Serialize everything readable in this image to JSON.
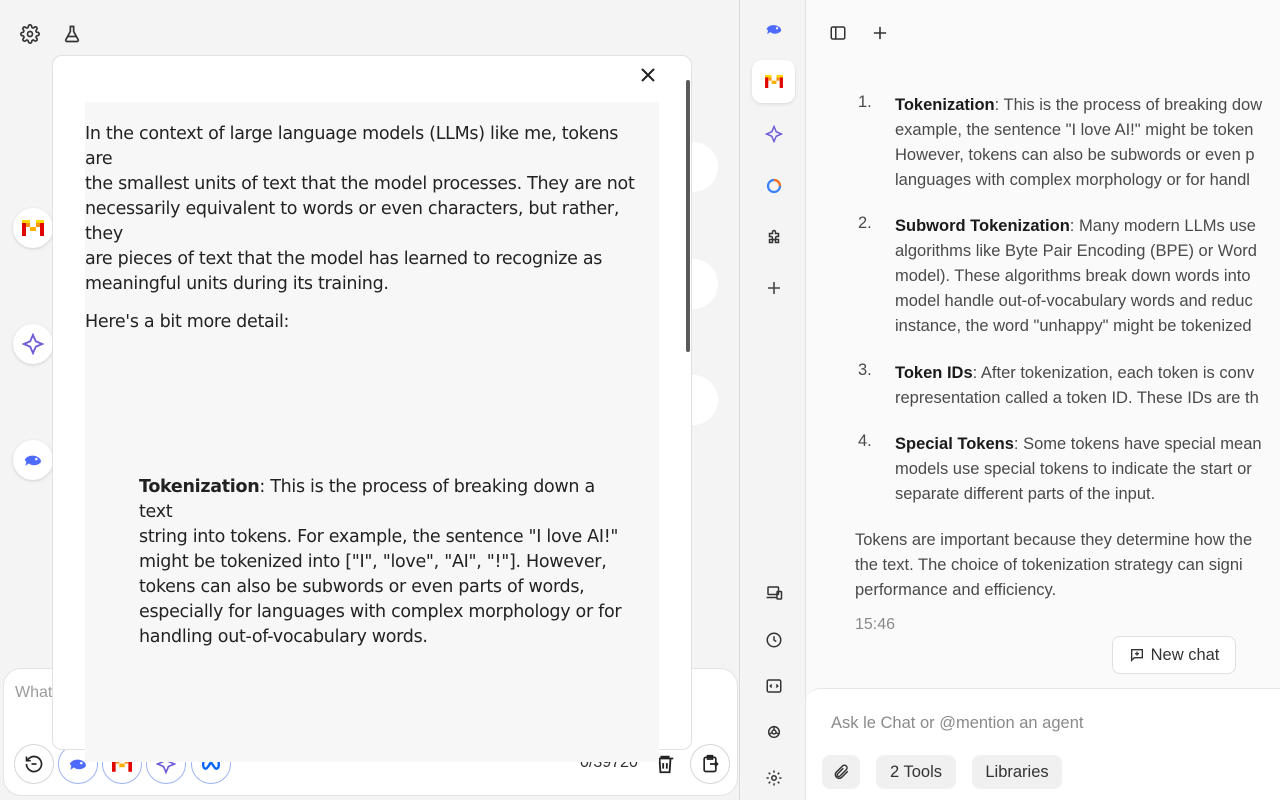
{
  "left_pane": {
    "composer_placeholder": "What",
    "char_count": "0/39720"
  },
  "modal": {
    "paragraph1": [
      "In the context of large language models (LLMs) like me, tokens are",
      "the smallest units of text that the model processes. They are not",
      "necessarily equivalent to words or even characters, but rather, they",
      "are pieces of text that the model has learned to recognize as",
      "meaningful units during its training."
    ],
    "paragraph2": "Here's a bit more detail:",
    "bullet_term": "Tokenization",
    "bullet_lines": [
      ": This is the process of breaking down a text",
      "string into tokens. For example, the sentence \"I love AI!\"",
      "might be tokenized into [\"I\", \"love\", \"AI\", \"!\"]. However,",
      "tokens can also be subwords or even parts of words,",
      "especially for languages with complex morphology or for",
      "handling out-of-vocabulary words."
    ]
  },
  "chat": {
    "list": [
      {
        "num": "1.",
        "term": "Tokenization",
        "lines": [
          ": This is the process of breaking dow",
          "example, the sentence \"I love AI!\" might be token",
          "However, tokens can also be subwords or even p",
          "languages with complex morphology or for handl"
        ]
      },
      {
        "num": "2.",
        "term": "Subword Tokenization",
        "lines": [
          ": Many modern LLMs use",
          "algorithms like Byte Pair Encoding (BPE) or Word",
          "model). These algorithms break down words into",
          "model handle out-of-vocabulary words and reduc",
          "instance, the word \"unhappy\" might be tokenized"
        ]
      },
      {
        "num": "3.",
        "term": "Token IDs",
        "lines": [
          ": After tokenization, each token is conv",
          "representation called a token ID. These IDs are th"
        ]
      },
      {
        "num": "4.",
        "term": "Special Tokens",
        "lines": [
          ": Some tokens have special mean",
          "models use special tokens to indicate the start or",
          "separate different parts of the input."
        ]
      }
    ],
    "closing": [
      "Tokens are important because they determine how the",
      "the text. The choice of tokenization strategy can signi",
      "performance and efficiency."
    ],
    "timestamp": "15:46",
    "new_chat_label": "New chat",
    "input_placeholder": "Ask le Chat or @mention an agent",
    "tools_label": "2 Tools",
    "libraries_label": "Libraries"
  },
  "colors": {
    "mistral_orange": "#f7931a",
    "mistral_red": "#e10500",
    "claude_purple": "#6f5bd6",
    "deepseek_blue": "#4d6bfe"
  }
}
